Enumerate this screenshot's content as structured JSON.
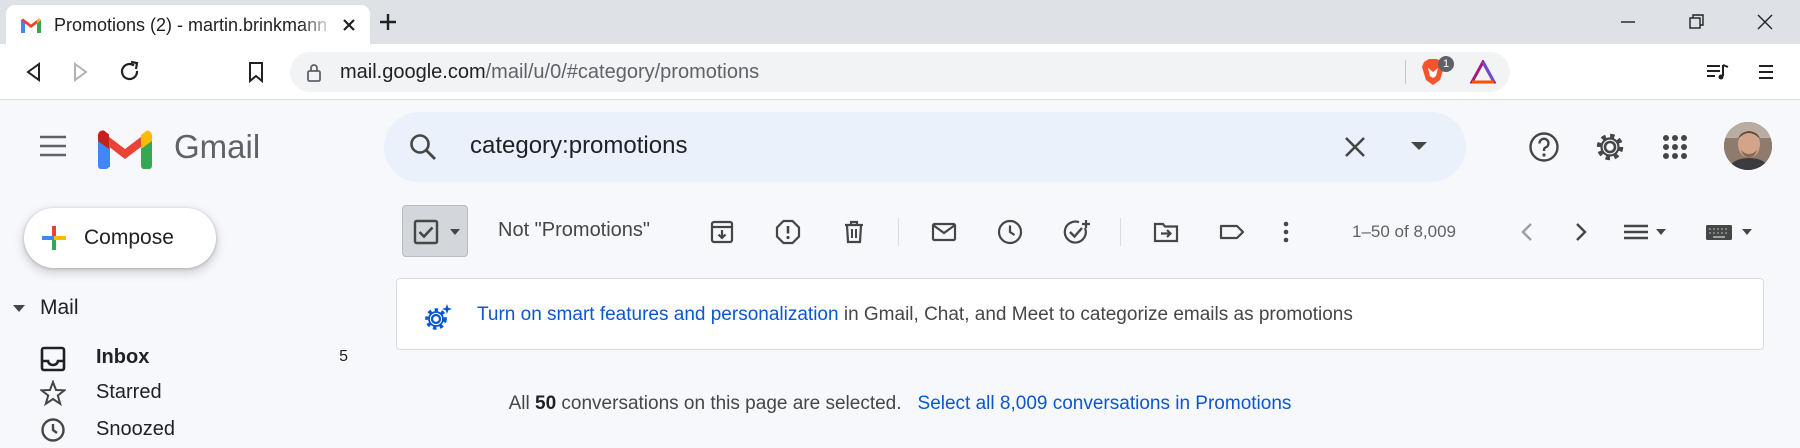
{
  "browser": {
    "tab_title": "Promotions (2) - martin.brinkmann",
    "url_host": "mail.google.com",
    "url_path": "/mail/u/0/#category/promotions",
    "brave_badge": "1"
  },
  "gmail": {
    "wordmark": "Gmail",
    "search_query": "category:promotions"
  },
  "sidebar": {
    "compose_label": "Compose",
    "section_label": "Mail",
    "items": [
      {
        "label": "Inbox",
        "count": "5",
        "bold": true
      },
      {
        "label": "Starred",
        "count": ""
      },
      {
        "label": "Snoozed",
        "count": ""
      }
    ]
  },
  "actions": {
    "not_category_label": "Not \"Promotions\"",
    "pagination": "1–50 of 8,009"
  },
  "banner": {
    "link": "Turn on smart features and personalization",
    "text": " in Gmail, Chat, and Meet to categorize emails as promotions"
  },
  "selection": {
    "prefix": "All ",
    "count": "50",
    "suffix": " conversations on this page are selected.",
    "select_all_link": "Select all 8,009 conversations in Promotions"
  },
  "colors": {
    "accent_blue": "#0b57d0",
    "gmail_red": "#ea4335",
    "gmail_blue": "#4285f4",
    "gmail_green": "#34a853",
    "gmail_yellow": "#fbbc04"
  }
}
